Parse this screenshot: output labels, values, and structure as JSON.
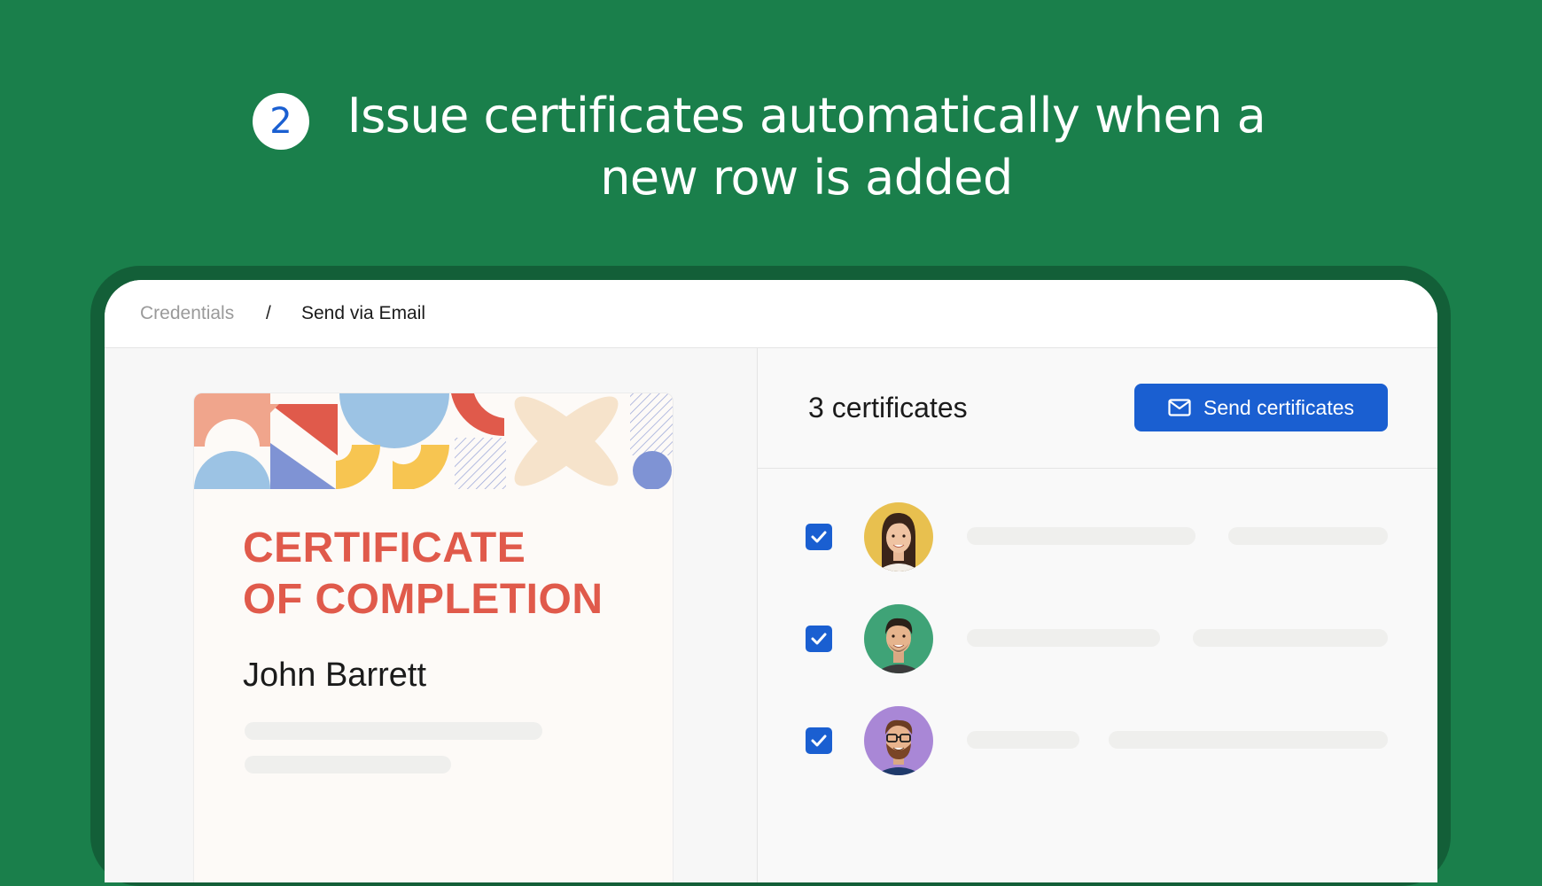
{
  "step": {
    "number": "2",
    "headline_line1": "Issue certificates automatically when a",
    "headline_line2": "new row is added"
  },
  "breadcrumb": {
    "items": [
      "Credentials",
      "Send via Email"
    ],
    "separator": "/"
  },
  "certificate": {
    "title_line1": "CERTIFICATE",
    "title_line2": "OF COMPLETION",
    "recipient": "John Barrett",
    "title_color": "#e05a4b"
  },
  "recipients_panel": {
    "count_label": "3 certificates",
    "send_button_label": "Send certificates",
    "send_button_icon": "mail-icon",
    "rows": [
      {
        "checked": true,
        "avatar_bg": "#e8c04f",
        "avatar_desc": "woman-avatar"
      },
      {
        "checked": true,
        "avatar_bg": "#3fa377",
        "avatar_desc": "man-avatar"
      },
      {
        "checked": true,
        "avatar_bg": "#a987d6",
        "avatar_desc": "bearded-man-avatar"
      }
    ]
  },
  "colors": {
    "background": "#1a7f4b",
    "frame": "#135f38",
    "accent_blue": "#1a5fd1"
  }
}
